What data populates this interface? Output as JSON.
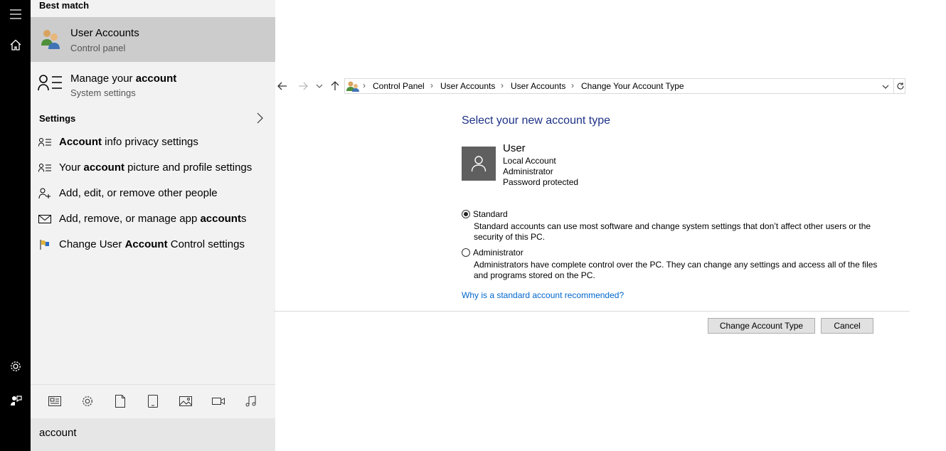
{
  "search_panel": {
    "best_match_header": "Best match",
    "best_match": {
      "title_pre": "User ",
      "title_bold": "Account",
      "title_post": "s",
      "subtitle": "Control panel"
    },
    "second_result": {
      "title_pre": "Manage your ",
      "title_bold": "account",
      "subtitle": "System settings"
    },
    "settings_header": "Settings",
    "settings_items": [
      {
        "icon": "account-info-icon",
        "pre": "",
        "bold": "Account",
        "post": " info privacy settings"
      },
      {
        "icon": "account-picture-icon",
        "pre": "Your ",
        "bold": "account",
        "post": " picture and profile settings"
      },
      {
        "icon": "add-person-icon",
        "pre": "Add, edit, or remove other people",
        "bold": "",
        "post": ""
      },
      {
        "icon": "mail-icon",
        "pre": "Add, remove, or manage app ",
        "bold": "account",
        "post": "s"
      },
      {
        "icon": "flag-icon",
        "pre": "Change User ",
        "bold": "Account",
        "post": " Control settings"
      }
    ],
    "filter_icons": [
      "news-icon",
      "gear-icon",
      "document-icon",
      "tablet-icon",
      "image-icon",
      "video-icon",
      "music-icon"
    ],
    "search_query": "account"
  },
  "control_panel": {
    "breadcrumbs": [
      "Control Panel",
      "User Accounts",
      "User Accounts",
      "Change Your Account Type"
    ],
    "heading": "Select your new account type",
    "user": {
      "name": "User",
      "lines": [
        "Local Account",
        "Administrator",
        "Password protected"
      ]
    },
    "options": [
      {
        "label": "Standard",
        "checked": true,
        "description": "Standard accounts can use most software and change system settings that don’t affect other users or the security of this PC."
      },
      {
        "label": "Administrator",
        "checked": false,
        "description": "Administrators have complete control over the PC. They can change any settings and access all of the files and programs stored on the PC."
      }
    ],
    "help_link": "Why is a standard account recommended?",
    "buttons": {
      "primary": "Change Account Type",
      "cancel": "Cancel"
    }
  },
  "colors": {
    "heading": "#1e3287",
    "link": "#0066cc",
    "rail": "#000000",
    "selected": "#cccccc"
  }
}
